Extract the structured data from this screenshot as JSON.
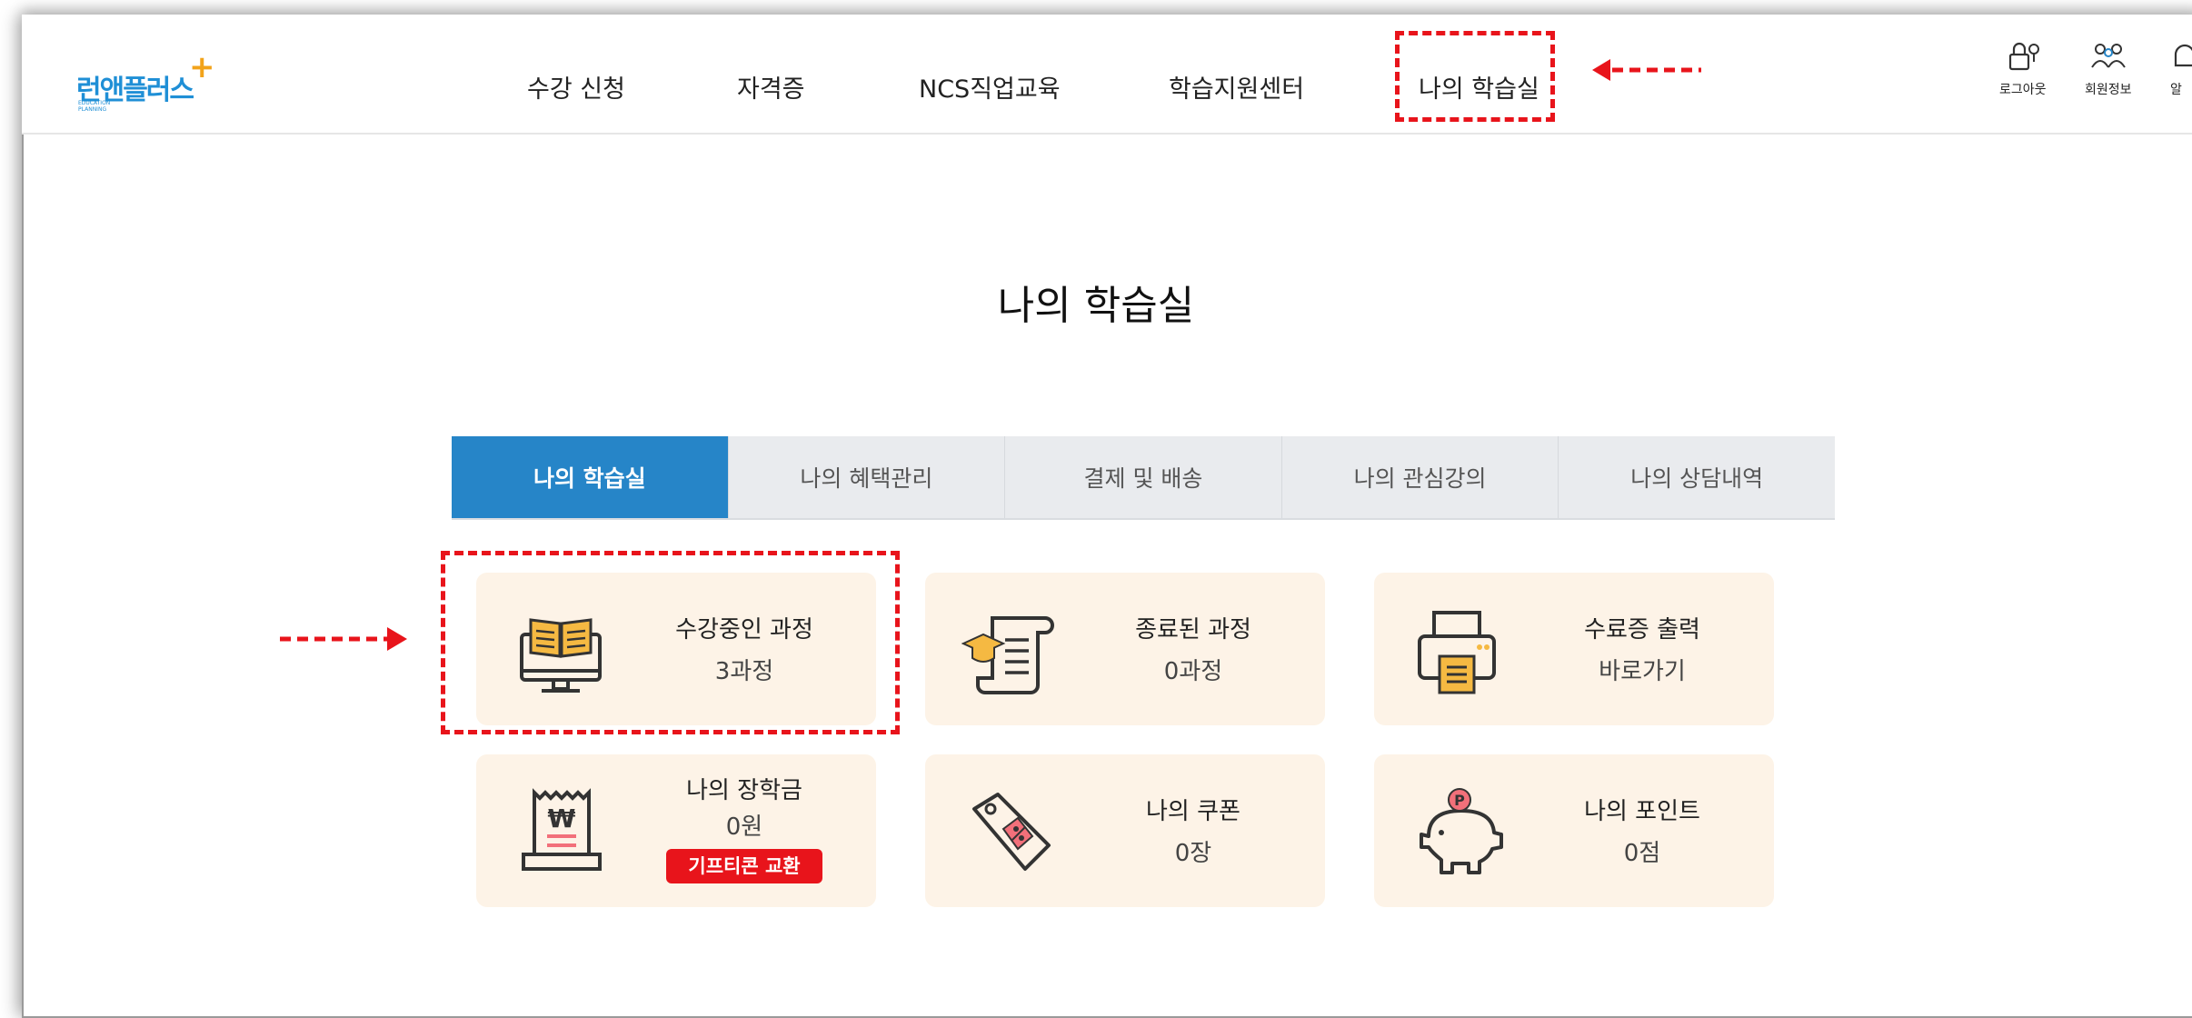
{
  "logo": {
    "text": "런앤플러스",
    "sub": "EDUCATION PLANNING"
  },
  "nav": {
    "items": [
      "수강 신청",
      "자격증",
      "NCS직업교육",
      "학습지원센터",
      "나의 학습실"
    ]
  },
  "tools": [
    {
      "label": "로그아웃",
      "icon": "lock-icon"
    },
    {
      "label": "회원정보",
      "icon": "people-icon"
    },
    {
      "label": "알",
      "icon": "bell-icon"
    }
  ],
  "page_title": "나의 학습실",
  "tabs": [
    "나의 학습실",
    "나의 혜택관리",
    "결제 및 배송",
    "나의 관심강의",
    "나의 상담내역"
  ],
  "cards": [
    {
      "title": "수강중인 과정",
      "value": "3과정",
      "icon": "open-book-monitor-icon"
    },
    {
      "title": "종료된 과정",
      "value": "0과정",
      "icon": "graduation-scroll-icon"
    },
    {
      "title": "수료증 출력",
      "value": "바로가기",
      "icon": "printer-icon"
    },
    {
      "title": "나의 장학금",
      "value": "0원",
      "icon": "receipt-won-icon",
      "badge": "기프티콘 교환"
    },
    {
      "title": "나의 쿠폰",
      "value": "0장",
      "icon": "coupon-tag-icon"
    },
    {
      "title": "나의 포인트",
      "value": "0점",
      "icon": "piggy-bank-icon"
    }
  ],
  "colors": {
    "accent": "#2685c8",
    "highlight": "#e8141b",
    "card_bg": "#fdf3e7",
    "tab_bg": "#e9ebee",
    "icon_orange": "#f5b942",
    "icon_red": "#f2707a"
  }
}
